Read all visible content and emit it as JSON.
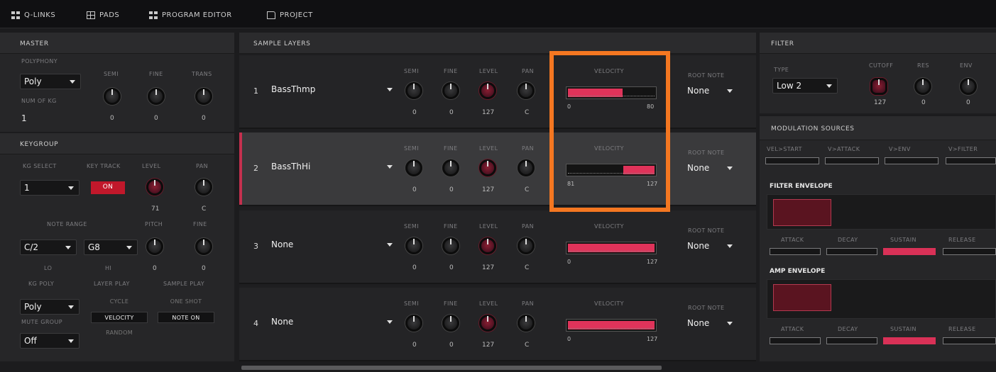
{
  "tabs": [
    {
      "label": "Q-LINKS",
      "icon": "grid-icon"
    },
    {
      "label": "PADS",
      "icon": "pads-icon"
    },
    {
      "label": "PROGRAM EDITOR",
      "icon": "grid-icon"
    },
    {
      "label": "PROJECT",
      "icon": "file-icon"
    }
  ],
  "master": {
    "title": "MASTER",
    "polyphony_label": "POLYPHONY",
    "polyphony_value": "Poly",
    "num_of_kg_label": "NUM OF KG",
    "num_of_kg_value": "1",
    "knobs": [
      {
        "label": "SEMI",
        "value": "0"
      },
      {
        "label": "FINE",
        "value": "0"
      },
      {
        "label": "TRANS",
        "value": "0"
      }
    ]
  },
  "keygroup": {
    "title": "KEYGROUP",
    "kg_select_label": "KG SELECT",
    "kg_select_value": "1",
    "key_track_label": "KEY TRACK",
    "key_track_value": "ON",
    "level_label": "LEVEL",
    "level_value": "71",
    "pan_label": "PAN",
    "pan_value": "C",
    "note_range_label": "NOTE RANGE",
    "pitch_label": "PITCH",
    "fine_label": "FINE",
    "lo_value": "C/2",
    "hi_value": "G8",
    "lo_label": "LO",
    "hi_label": "HI",
    "pitch_value": "0",
    "fine_value": "0",
    "kg_poly_label": "KG POLY",
    "kg_poly_value": "Poly",
    "mute_group_label": "MUTE GROUP",
    "mute_group_value": "Off",
    "layer_play_label": "LAYER PLAY",
    "layer_play_options": [
      "CYCLE",
      "VELOCITY",
      "RANDOM"
    ],
    "sample_play_label": "SAMPLE PLAY",
    "sample_play_options": [
      "ONE SHOT",
      "NOTE ON"
    ]
  },
  "sample_layers": {
    "title": "SAMPLE LAYERS",
    "col_labels": {
      "semi": "SEMI",
      "fine": "FINE",
      "level": "LEVEL",
      "pan": "PAN",
      "velocity": "VELOCITY",
      "root_note": "ROOT NOTE"
    },
    "layers": [
      {
        "num": "1",
        "sample": "BassThmp",
        "semi": "0",
        "fine": "0",
        "level": "127",
        "pan": "C",
        "vel_lo": "0",
        "vel_hi": "80",
        "vel_start": 0.0,
        "vel_end": 0.63,
        "root": "None"
      },
      {
        "num": "2",
        "sample": "BassThHi",
        "semi": "0",
        "fine": "0",
        "level": "127",
        "pan": "C",
        "vel_lo": "81",
        "vel_hi": "127",
        "vel_start": 0.64,
        "vel_end": 1.0,
        "root": "None"
      },
      {
        "num": "3",
        "sample": "None",
        "semi": "0",
        "fine": "0",
        "level": "127",
        "pan": "C",
        "vel_lo": "0",
        "vel_hi": "127",
        "vel_start": 0.0,
        "vel_end": 1.0,
        "root": "None"
      },
      {
        "num": "4",
        "sample": "None",
        "semi": "0",
        "fine": "0",
        "level": "127",
        "pan": "C",
        "vel_lo": "0",
        "vel_hi": "127",
        "vel_start": 0.0,
        "vel_end": 1.0,
        "root": "None"
      }
    ]
  },
  "filter": {
    "title": "FILTER",
    "type_label": "TYPE",
    "type_value": "Low 2",
    "knobs": [
      {
        "label": "CUTOFF",
        "value": "127"
      },
      {
        "label": "RES",
        "value": "0"
      },
      {
        "label": "ENV",
        "value": "0"
      }
    ]
  },
  "modulation": {
    "title": "MODULATION SOURCES",
    "labels": [
      "VEL>START",
      "V>ATTACK",
      "V>ENV",
      "V>FILTER"
    ],
    "filter_env_label": "FILTER ENVELOPE",
    "amp_env_label": "AMP ENVELOPE",
    "env_labels": [
      "ATTACK",
      "DECAY",
      "SUSTAIN",
      "RELEASE"
    ]
  },
  "colors": {
    "accent": "#e0335a",
    "highlight": "#f47721",
    "background": "#1c1c1e"
  }
}
